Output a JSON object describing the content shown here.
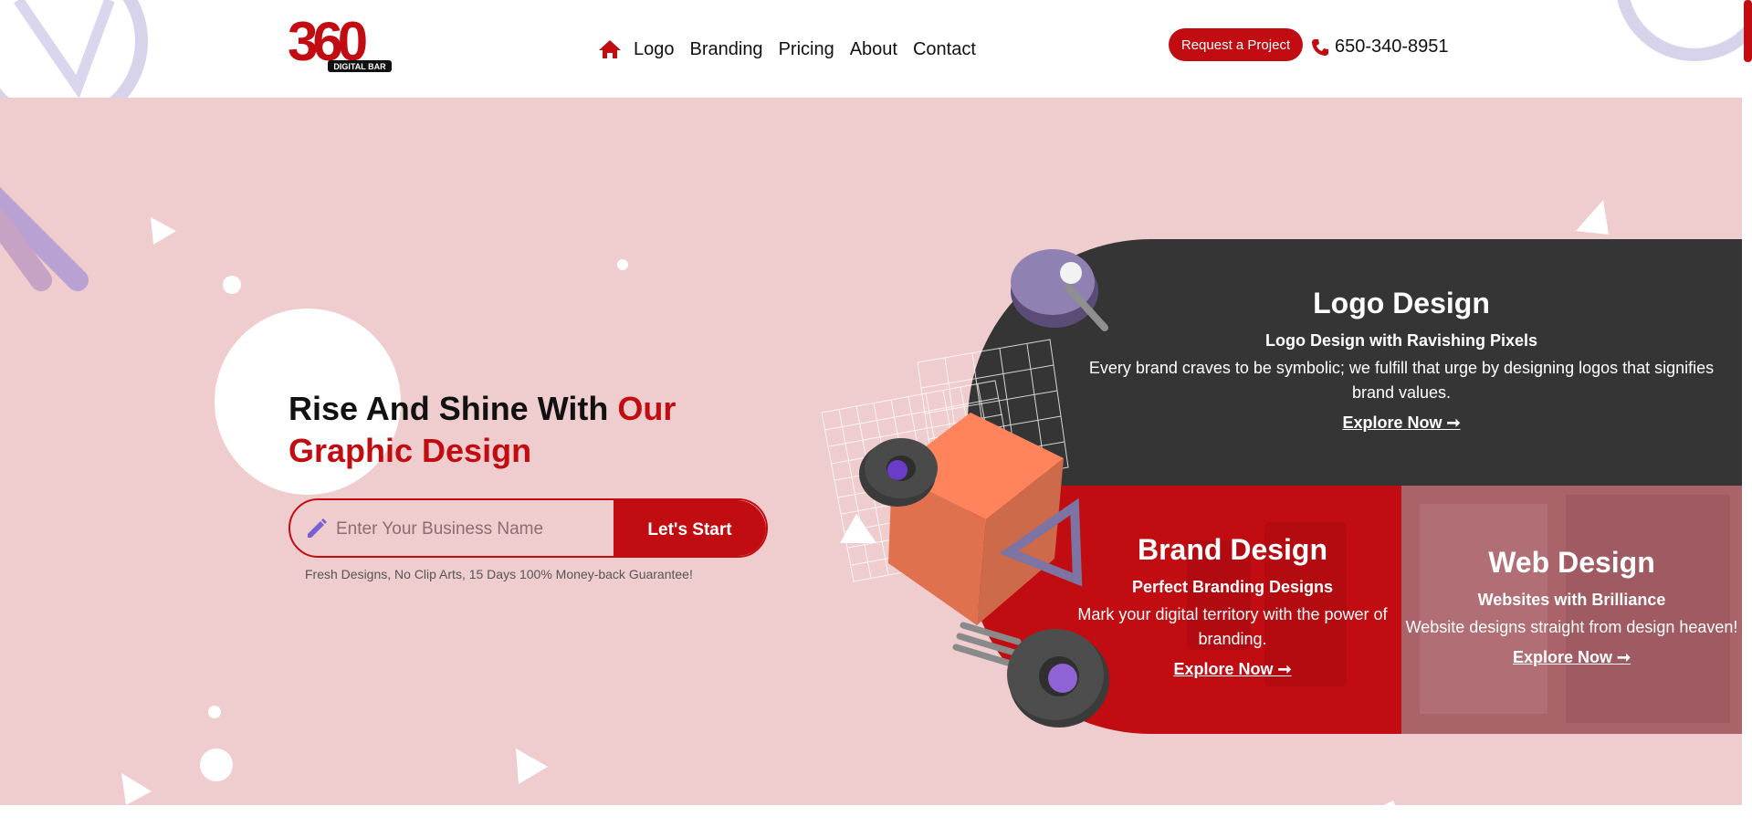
{
  "header": {
    "logo_mark": "360",
    "logo_sub": "DIGITAL BAR",
    "nav": [
      "Logo",
      "Branding",
      "Pricing",
      "About",
      "Contact"
    ],
    "home_icon": "home-icon",
    "request_label": "Request a Project",
    "phone_icon": "phone-icon",
    "phone": "650-340-8951"
  },
  "hero": {
    "title_black": "Rise And Shine With ",
    "title_red": "Our Graphic Design",
    "input_placeholder": "Enter Your Business Name",
    "start_label": "Let's Start",
    "guarantee": "Fresh Designs, No Clip Arts, 15 Days 100% Money-back Guarantee!"
  },
  "cards": {
    "logo": {
      "title": "Logo Design",
      "subtitle": "Logo Design with Ravishing Pixels",
      "text": "Every brand craves to be symbolic; we fulfill that urge by designing logos that signifies brand values.",
      "explore": "Explore Now ➞"
    },
    "brand": {
      "title": "Brand Design",
      "subtitle": "Perfect Branding Designs",
      "text": "Mark your digital territory with the power of branding.",
      "explore": "Explore Now ➞"
    },
    "web": {
      "title": "Web Design",
      "subtitle": "Websites with Brilliance",
      "text": "Website designs straight from design heaven!",
      "explore": "Explore Now ➞"
    }
  },
  "colors": {
    "brand_red": "#c10c12",
    "hero_bg": "#efcccd",
    "dark_card": "#353535",
    "web_card": "#a96369",
    "accent_purple": "#7a5fd0"
  }
}
